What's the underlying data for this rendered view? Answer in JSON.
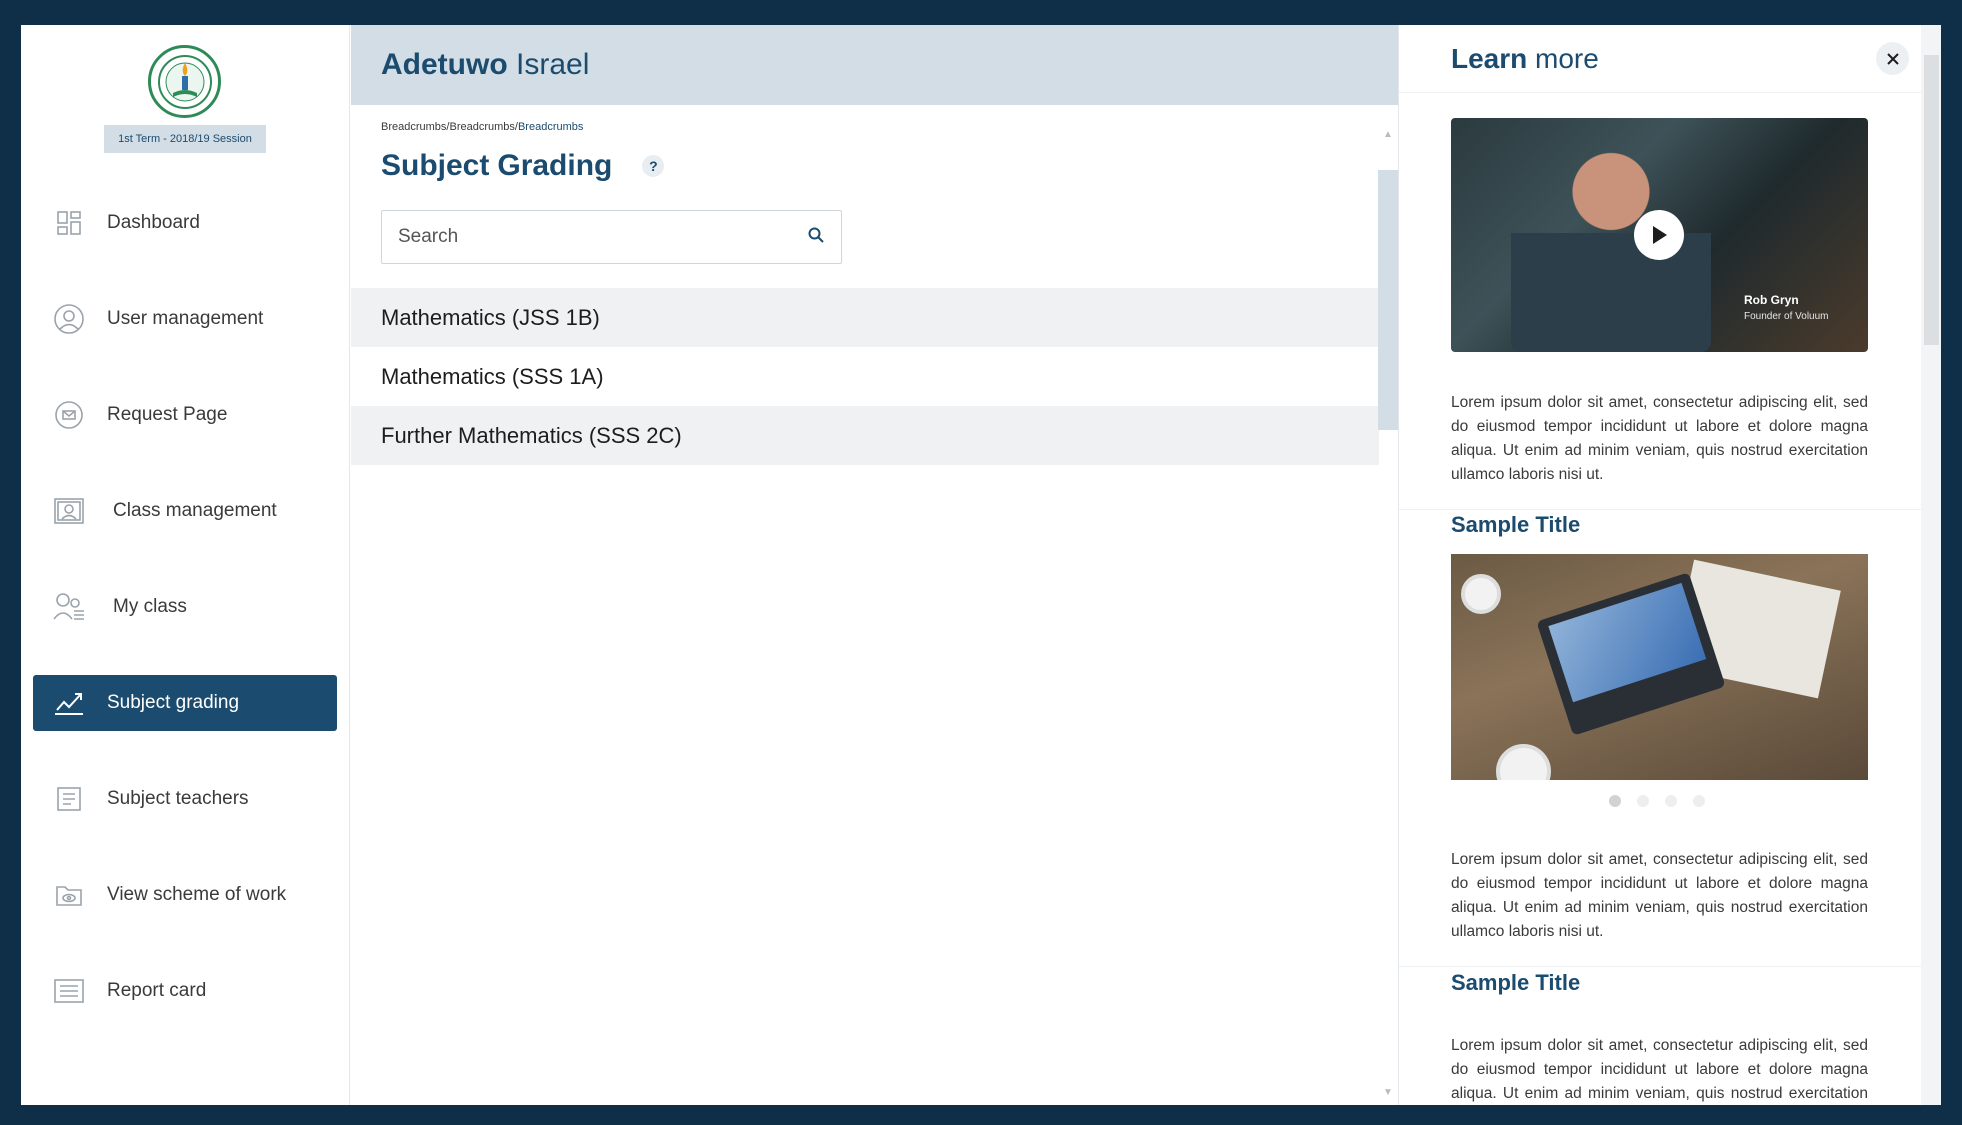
{
  "sidebar": {
    "session_label": "1st Term - 2018/19 Session",
    "items": [
      {
        "label": "Dashboard",
        "icon": "dashboard-icon"
      },
      {
        "label": "User management",
        "icon": "user-icon"
      },
      {
        "label": "Request Page",
        "icon": "mail-icon"
      },
      {
        "label": "Class management",
        "icon": "class-icon"
      },
      {
        "label": "My class",
        "icon": "group-icon"
      },
      {
        "label": "Subject grading",
        "icon": "chart-check-icon",
        "active": true
      },
      {
        "label": "Subject teachers",
        "icon": "teacher-list-icon"
      },
      {
        "label": "View scheme of work",
        "icon": "folder-eye-icon"
      },
      {
        "label": "Report card",
        "icon": "list-icon"
      }
    ]
  },
  "header": {
    "first_name": "Adetuwo",
    "last_name": "Israel"
  },
  "breadcrumbs": {
    "item1": "Breadcrumbs",
    "item2": "Breadcrumbs",
    "current": "Breadcrumbs",
    "separator": "/"
  },
  "page": {
    "title_bold": "Subject",
    "title_light": "Grading",
    "help_label": "?"
  },
  "search": {
    "placeholder": "Search"
  },
  "subjects": [
    "Mathematics (JSS 1B)",
    "Mathematics (SSS 1A)",
    "Further Mathematics (SSS 2C)"
  ],
  "learn_more": {
    "title_bold": "Learn",
    "title_light": "more",
    "close_label": "×",
    "video": {
      "presenter_name": "Rob Gryn",
      "presenter_role": "Founder of Voluum"
    },
    "paragraph1": "Lorem ipsum dolor sit amet, consectetur adipiscing elit, sed do eiusmod tempor incididunt ut labore et dolore magna aliqua. Ut enim ad minim veniam, quis nostrud exercitation ullamco laboris nisi ut.",
    "section2_title": "Sample Title",
    "paragraph2": "Lorem ipsum dolor sit amet, consectetur adipiscing elit, sed do eiusmod tempor incididunt ut labore et dolore magna aliqua. Ut enim ad minim veniam, quis nostrud exercitation ullamco laboris nisi ut.",
    "section3_title": "Sample Title",
    "paragraph3": "Lorem ipsum dolor sit amet, consectetur adipiscing elit, sed do eiusmod tempor incididunt ut labore et dolore magna aliqua. Ut enim ad minim veniam, quis nostrud exercitation ullamco laboris nisi ut.",
    "carousel_count": 4,
    "carousel_active": 1
  },
  "colors": {
    "brand": "#1b4b6e",
    "background": "#0f2f48",
    "header_bg": "#d3dde6"
  }
}
